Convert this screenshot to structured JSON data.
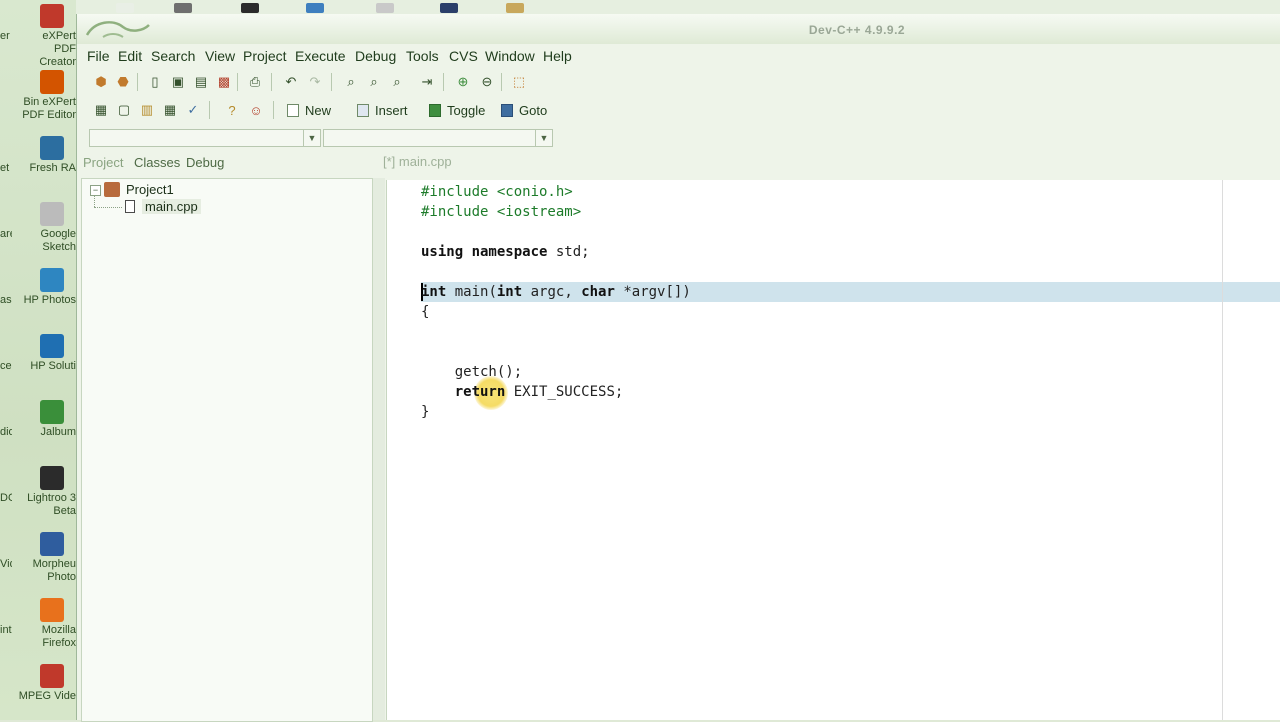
{
  "window": {
    "title": "Dev-C++ 4.9.9.2"
  },
  "menu": [
    "File",
    "Edit",
    "Search",
    "View",
    "Project",
    "Execute",
    "Debug",
    "Tools",
    "CVS",
    "Window",
    "Help"
  ],
  "toolbar2": {
    "new_label": "New",
    "insert_label": "Insert",
    "toggle_label": "Toggle",
    "goto_label": "Goto"
  },
  "left_tabs": [
    "Project",
    "Classes",
    "Debug"
  ],
  "project_tree": {
    "project_name": "Project1",
    "file_name": "main.cpp"
  },
  "editor": {
    "tab_label": "[*] main.cpp",
    "lines": [
      {
        "segments": [
          {
            "t": "#include <conio.h>",
            "c": "pp"
          }
        ]
      },
      {
        "segments": [
          {
            "t": "#include <iostream>",
            "c": "pp"
          }
        ]
      },
      {
        "segments": []
      },
      {
        "segments": [
          {
            "t": "using namespace",
            "c": "kw"
          },
          {
            "t": " std;",
            "c": ""
          }
        ]
      },
      {
        "segments": []
      },
      {
        "segments": [
          {
            "t": "int",
            "c": "kw"
          },
          {
            "t": " main(",
            "c": ""
          },
          {
            "t": "int",
            "c": "kw"
          },
          {
            "t": " argc, ",
            "c": ""
          },
          {
            "t": "char",
            "c": "kw"
          },
          {
            "t": " *argv[])",
            "c": ""
          }
        ]
      },
      {
        "segments": [
          {
            "t": "{",
            "c": ""
          }
        ]
      },
      {
        "segments": []
      },
      {
        "segments": []
      },
      {
        "segments": [
          {
            "t": "    getch();",
            "c": ""
          }
        ]
      },
      {
        "segments": [
          {
            "t": "    ",
            "c": ""
          },
          {
            "t": "return",
            "c": "kw"
          },
          {
            "t": " EXIT_SUCCESS;",
            "c": ""
          }
        ]
      },
      {
        "segments": [
          {
            "t": "}",
            "c": ""
          }
        ]
      }
    ]
  },
  "desktop_icons": [
    {
      "label": "eXPert PDF Creator",
      "icon": "pdf-creator-icon",
      "color": "#c0392b",
      "side": "er"
    },
    {
      "label": "Bin eXPert PDF Editor",
      "icon": "pdf-editor-icon",
      "color": "#d35400",
      "side": ""
    },
    {
      "label": "Fresh RA",
      "icon": "fresh-ram-icon",
      "color": "#2c6ea0",
      "side": "et er"
    },
    {
      "label": "Google Sketch",
      "icon": "sketchup-icon",
      "color": "#bbbbbb",
      "side": "are"
    },
    {
      "label": "HP Photos",
      "icon": "hp-photos-icon",
      "color": "#2e86c1",
      "side": "ask er"
    },
    {
      "label": "HP Soluti",
      "icon": "hp-solution-icon",
      "color": "#1f6fb2",
      "side": "ce"
    },
    {
      "label": "Jalbum",
      "icon": "jalbum-icon",
      "color": "#3a8f3a",
      "side": "dio"
    },
    {
      "label": "Lightroo 3 Beta",
      "icon": "lightroom-icon",
      "color": "#2b2b2b",
      "side": "DO"
    },
    {
      "label": "Morpheu Photo",
      "icon": "morpheus-icon",
      "color": "#2f5d9e",
      "side": "Vid"
    },
    {
      "label": "Mozilla Firefox",
      "icon": "firefox-icon",
      "color": "#e8711c",
      "side": "int o X"
    },
    {
      "label": "MPEG Vide",
      "icon": "mpeg-video-icon",
      "color": "#c0392b",
      "side": ""
    }
  ]
}
